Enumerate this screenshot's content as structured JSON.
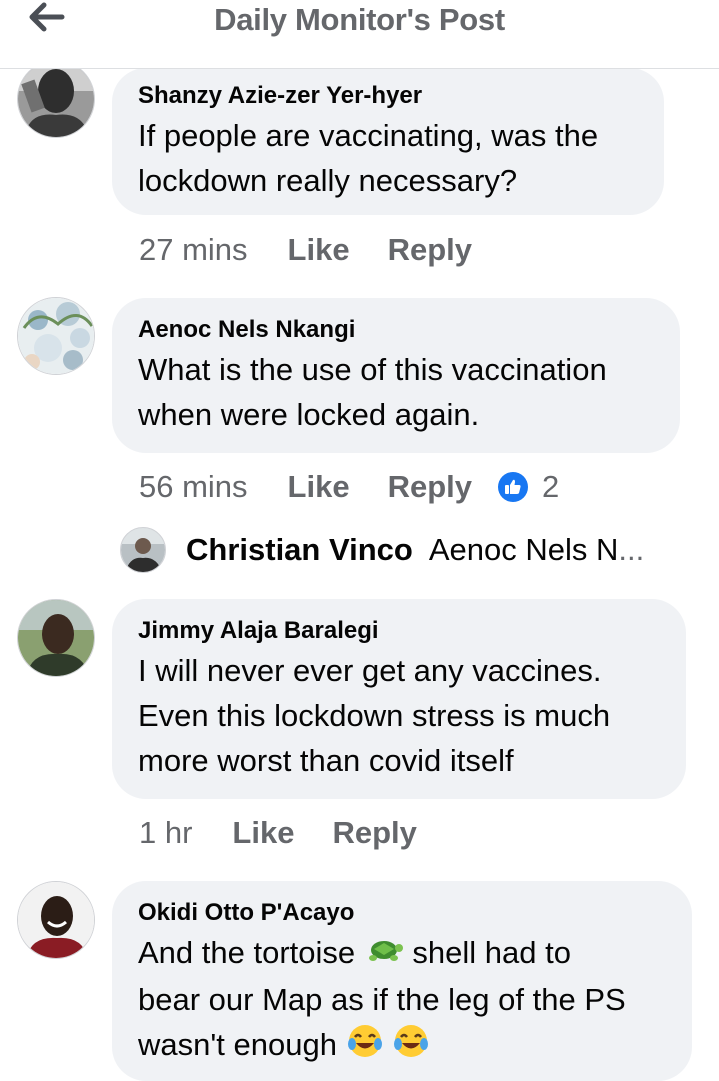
{
  "header": {
    "title": "Daily Monitor's Post",
    "back_icon": "arrow-left-icon"
  },
  "comments": [
    {
      "author": "Shanzy Azie-zer Yer-hyer",
      "text_lines": [
        "If people are vaccinating, was the",
        "lockdown really necessary?"
      ],
      "time": "27 mins",
      "like_label": "Like",
      "reply_label": "Reply"
    },
    {
      "author": "Aenoc Nels Nkangi",
      "text_lines": [
        "What is the use of this vaccination",
        "when were locked again."
      ],
      "time": "56 mins",
      "like_label": "Like",
      "reply_label": "Reply",
      "reaction_count": "2",
      "reaction_icon": "thumbs-up-icon",
      "reply_preview": {
        "author": "Christian Vinco",
        "snippet": "Aenoc Nels N",
        "ellipsis": "..."
      }
    },
    {
      "author": "Jimmy Alaja Baralegi",
      "text_lines": [
        "I will never ever get any vaccines.",
        "Even this lockdown stress is much",
        "more worst than covid itself"
      ],
      "time": "1 hr",
      "like_label": "Like",
      "reply_label": "Reply"
    },
    {
      "author": "Okidi Otto P'Acayo",
      "text_line1_a": "And the tortoise",
      "text_line1_b": "shell had to",
      "text_line2": "bear our Map as if the leg of the PS",
      "text_line3": "wasn't enough",
      "emoji_icons": [
        "turtle-icon",
        "tears-of-joy-icon",
        "tears-of-joy-icon"
      ]
    }
  ],
  "colors": {
    "bubble": "#f0f2f5",
    "meta": "#65676b",
    "like_blue": "#1877f2",
    "text": "#050505"
  }
}
